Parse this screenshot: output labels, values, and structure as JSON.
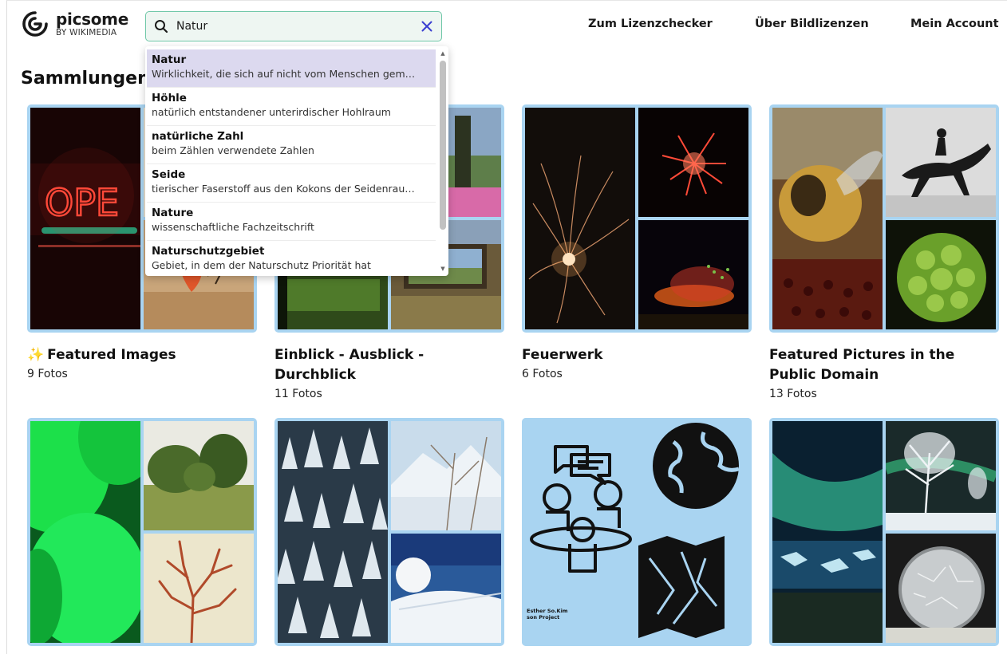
{
  "brand": {
    "name": "picsome",
    "subtitle": "BY WIKIMEDIA"
  },
  "search": {
    "value": "Natur",
    "placeholder": ""
  },
  "nav": [
    {
      "label": "Zum Lizenzchecker"
    },
    {
      "label": "Über Bildlizenzen"
    },
    {
      "label": "Mein Account"
    }
  ],
  "suggestions": [
    {
      "title": "Natur",
      "description": "Wirklichkeit, die sich auf nicht vom Menschen gem…",
      "active": true
    },
    {
      "title": "Höhle",
      "description": "natürlich entstandener unterirdischer Hohlraum"
    },
    {
      "title": "natürliche Zahl",
      "description": "beim Zählen verwendete Zahlen"
    },
    {
      "title": "Seide",
      "description": "tierischer Faserstoff aus den Kokons der Seidenrau…"
    },
    {
      "title": "Nature",
      "description": "wissenschaftliche Fachzeitschrift"
    },
    {
      "title": "Naturschutzgebiet",
      "description": "Gebiet, in dem der Naturschutz Priorität hat"
    }
  ],
  "section_title": "Sammlungen",
  "collections": [
    {
      "title": "Featured Images",
      "prefix": "✨",
      "count": "9 Fotos"
    },
    {
      "title": "Einblick - Ausblick - Durchblick",
      "count": "11 Fotos"
    },
    {
      "title": "Feuerwerk",
      "count": "6 Fotos"
    },
    {
      "title": "Featured Pictures in the Public Domain",
      "count": "13 Fotos"
    },
    {
      "title": "",
      "count": ""
    },
    {
      "title": "",
      "count": ""
    },
    {
      "title": "",
      "count": ""
    },
    {
      "title": "",
      "count": ""
    }
  ],
  "thumbnail_text": {
    "esther_credit": "Esther So.Kim\nson Project"
  },
  "colors": {
    "accent": "#6fc7a8",
    "mosaic_border": "#a9d4f1",
    "suggestion_active": "#dcd9ef",
    "clear_icon": "#3b3fd1"
  }
}
